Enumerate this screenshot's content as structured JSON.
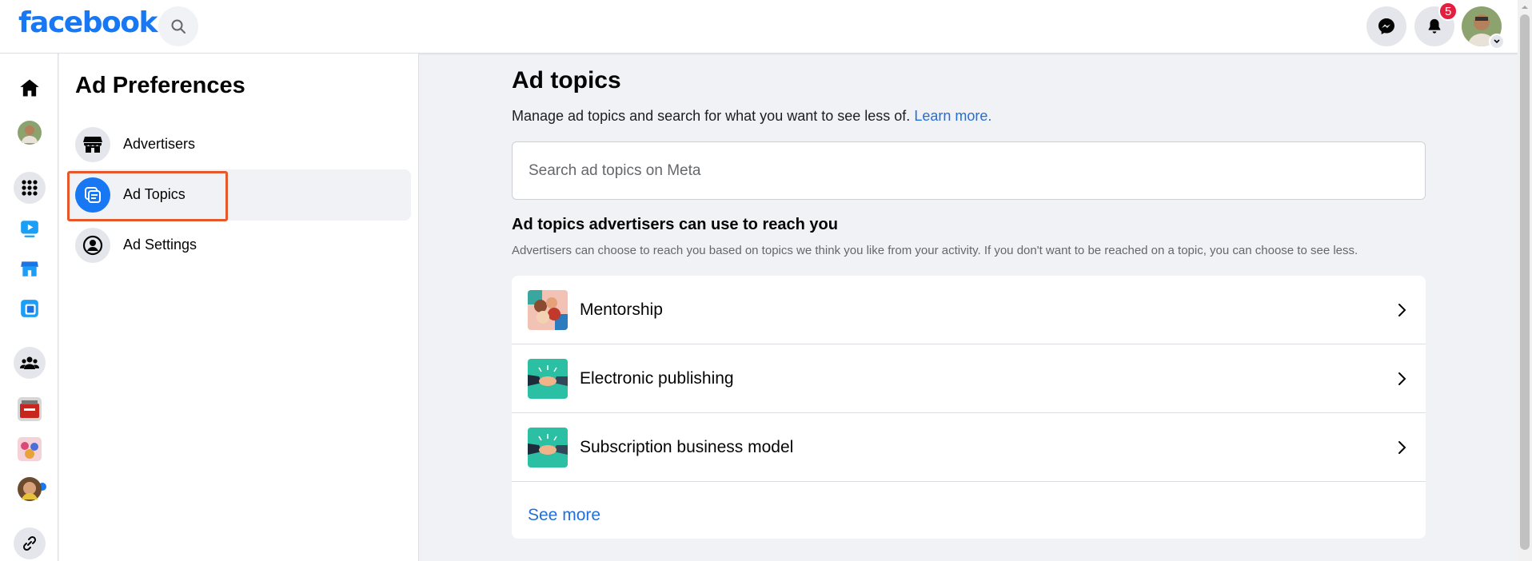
{
  "header": {
    "logo": "facebook",
    "notification_count": "5",
    "search_icon": "search-icon",
    "messenger_icon": "messenger-icon",
    "notifications_icon": "bell-icon"
  },
  "rail": {
    "items": [
      "home-icon",
      "profile-avatar",
      "apps-grid-icon",
      "watch-icon",
      "marketplace-icon",
      "feeds-icon",
      "groups-icon",
      "shortcut-game-icon",
      "shortcut-group-icon",
      "shortcut-page-icon",
      "link-icon"
    ]
  },
  "sidebar": {
    "title": "Ad Preferences",
    "items": [
      {
        "label": "Advertisers",
        "icon": "storefront-icon",
        "active": false
      },
      {
        "label": "Ad Topics",
        "icon": "ad-topics-icon",
        "active": true
      },
      {
        "label": "Ad Settings",
        "icon": "person-circle-icon",
        "active": false
      }
    ]
  },
  "main": {
    "title": "Ad topics",
    "description": "Manage ad topics and search for what you want to see less of.",
    "learn_more": "Learn more.",
    "search_placeholder": "Search ad topics on Meta",
    "section_title": "Ad topics advertisers can use to reach you",
    "section_description": "Advertisers can choose to reach you based on topics we think you like from your activity. If you don't want to be reached on a topic, you can choose to see less.",
    "topics": [
      {
        "label": "Mentorship"
      },
      {
        "label": "Electronic publishing"
      },
      {
        "label": "Subscription business model"
      }
    ],
    "see_more": "See more"
  },
  "colors": {
    "brand_blue": "#1877f2",
    "link_blue": "#216fdb",
    "badge_red": "#e41e3f",
    "highlight_orange": "#e4582c"
  }
}
